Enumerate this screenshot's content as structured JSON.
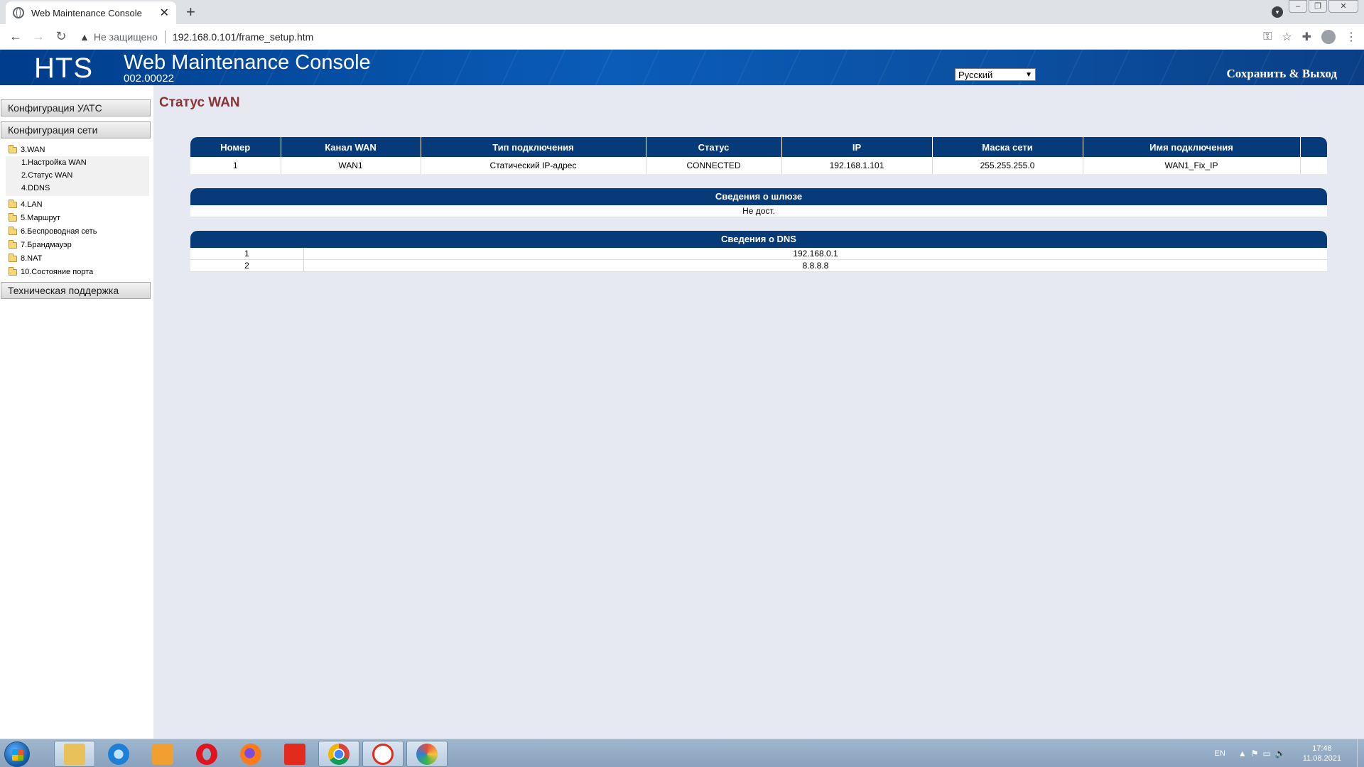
{
  "browser": {
    "tab_title": "Web Maintenance Console",
    "new_tab": "+",
    "insecure_label": "Не защищено",
    "url": "192.168.0.101/frame_setup.htm"
  },
  "header": {
    "brand": "HTS",
    "title": "Web Maintenance Console",
    "version": "002.00022",
    "language": "Русский",
    "save_exit": "Сохранить & Выход"
  },
  "sidebar": {
    "pbx_config": "Конфигурация УАТС",
    "net_config": "Конфигурация сети",
    "wan": "3.WAN",
    "wan_sub": [
      "1.Настройка WAN",
      "2.Статус WAN",
      "4.DDNS"
    ],
    "items": [
      "4.LAN",
      "5.Маршрут",
      "6.Беспроводная сеть",
      "7.Брандмауэр",
      "8.NAT",
      "10.Состояние порта"
    ],
    "support": "Техническая поддержка"
  },
  "main": {
    "title": "Статус WAN",
    "wan_table": {
      "headers": [
        "Номер",
        "Канал WAN",
        "Тип подключения",
        "Статус",
        "IP",
        "Маска сети",
        "Имя подключения",
        ""
      ],
      "row": [
        "1",
        "WAN1",
        "Статический IP-адрес",
        "CONNECTED",
        "192.168.1.101",
        "255.255.255.0",
        "WAN1_Fix_IP",
        ""
      ]
    },
    "gateway": {
      "header": "Сведения о шлюзе",
      "value": "Не дост."
    },
    "dns": {
      "header": "Сведения о DNS",
      "rows": [
        {
          "num": "1",
          "value": "192.168.0.1"
        },
        {
          "num": "2",
          "value": "8.8.8.8"
        }
      ]
    }
  },
  "taskbar": {
    "lang": "EN",
    "time": "17:48",
    "date": "11.08.2021"
  },
  "colors": {
    "header_blue": "#0a5cb8",
    "table_head": "#073a78",
    "title_red": "#8b3232"
  }
}
